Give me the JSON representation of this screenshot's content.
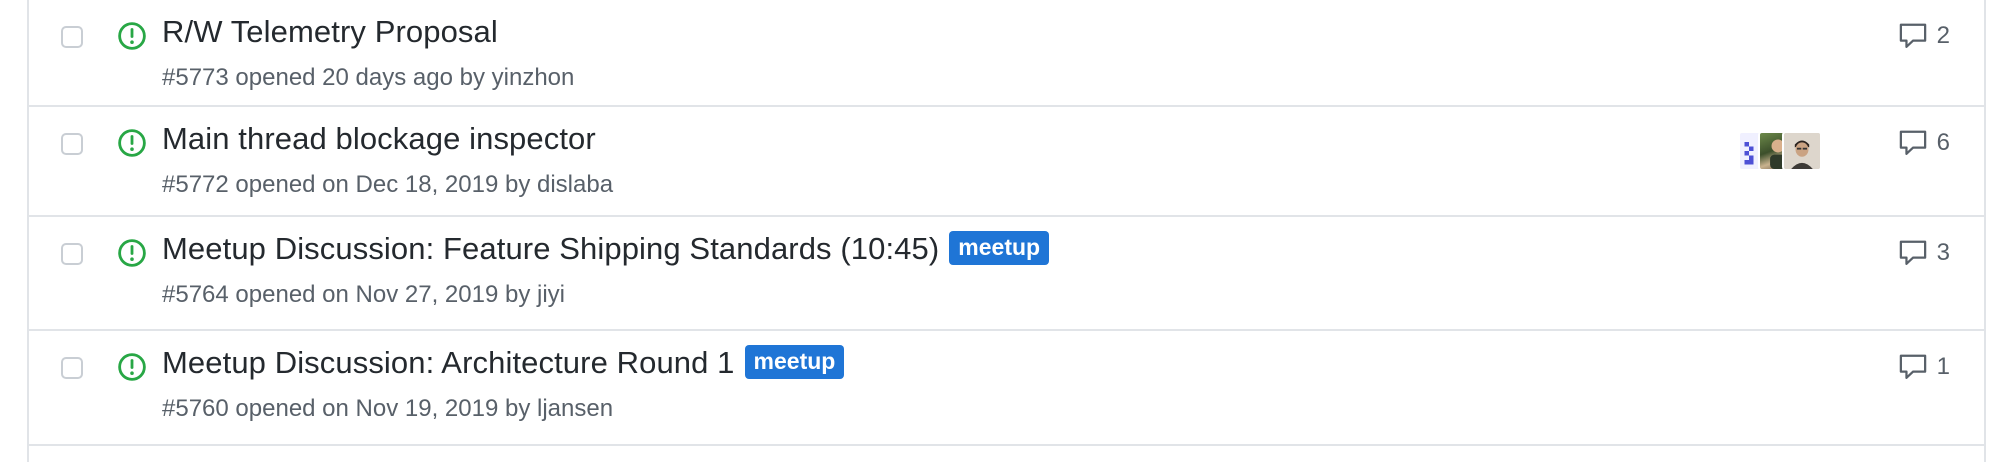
{
  "colors": {
    "open_icon": "#28a745",
    "label_bg": "#1f75d6",
    "label_text": "#ffffff",
    "muted_text": "#586069",
    "title_text": "#24292e",
    "border": "#e1e4e8"
  },
  "issues": [
    {
      "title": "R/W Telemetry Proposal",
      "number": "#5773",
      "opened_text": "opened 20 days ago by",
      "author": "yinzhon",
      "labels": [],
      "assignees": [],
      "comments": "2",
      "state_icon": "issue-opened-icon"
    },
    {
      "title": "Main thread blockage inspector",
      "number": "#5772",
      "opened_text": "opened on Dec 18, 2019 by",
      "author": "dislaba",
      "labels": [],
      "assignees": [
        "identicon-avatar",
        "photo-avatar",
        "photo-avatar"
      ],
      "comments": "6",
      "state_icon": "issue-opened-icon"
    },
    {
      "title": "Meetup Discussion: Feature Shipping Standards (10:45)",
      "number": "#5764",
      "opened_text": "opened on Nov 27, 2019 by",
      "author": "jiyi",
      "labels": [
        "meetup"
      ],
      "assignees": [],
      "comments": "3",
      "state_icon": "issue-opened-icon"
    },
    {
      "title": "Meetup Discussion: Architecture Round 1",
      "number": "#5760",
      "opened_text": "opened on Nov 19, 2019 by",
      "author": "ljansen",
      "labels": [
        "meetup"
      ],
      "assignees": [],
      "comments": "1",
      "state_icon": "issue-opened-icon"
    }
  ]
}
